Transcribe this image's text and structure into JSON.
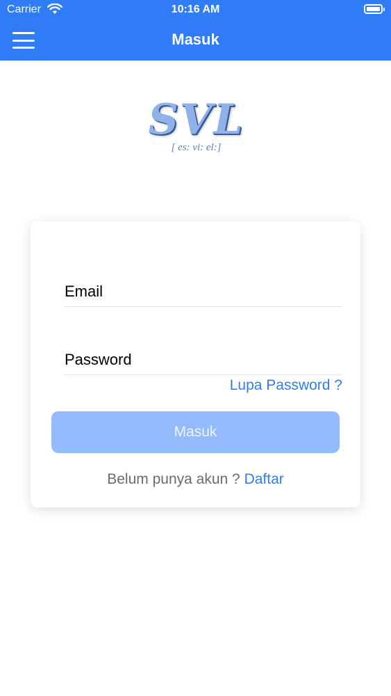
{
  "status_bar": {
    "carrier": "Carrier",
    "time": "10:16 AM"
  },
  "nav": {
    "title": "Masuk",
    "menu_icon": "hamburger-menu-icon"
  },
  "logo": {
    "main": "SVL",
    "subtitle": "[ es: vi: el:]"
  },
  "form": {
    "email_placeholder": "Email",
    "password_placeholder": "Password",
    "forgot_password": "Lupa Password ?",
    "login_button": "Masuk",
    "register_prompt": "Belum punya akun ?",
    "register_link": "Daftar"
  },
  "colors": {
    "primary": "#2f7cf6",
    "button_disabled": "#93bbfb"
  }
}
